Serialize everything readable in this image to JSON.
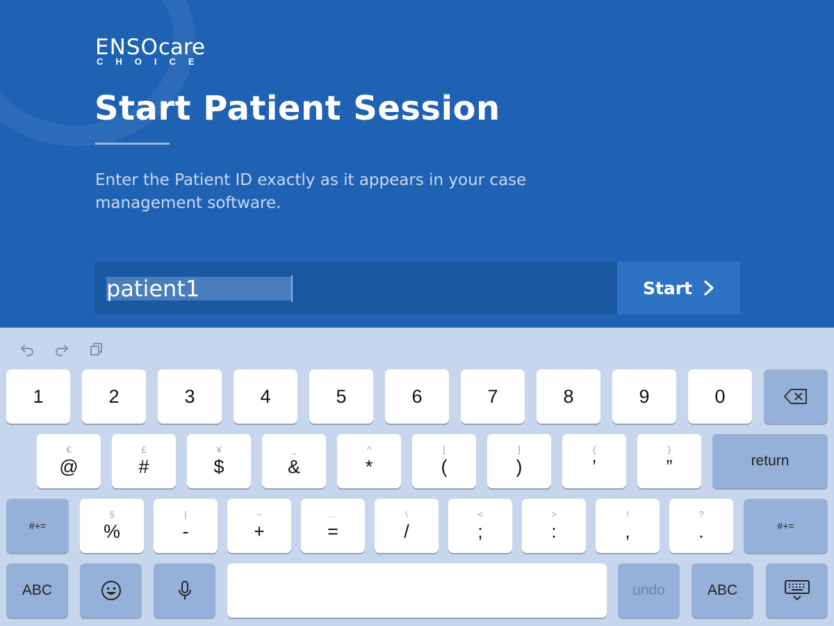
{
  "app": {
    "logo_brand_part1": "ENSO",
    "logo_brand_part2": "care",
    "logo_sub": "CHOICE",
    "title": "Start Patient Session",
    "instructions": "Enter the Patient ID exactly as it appears in your case management software.",
    "patient_id_value": "patient1",
    "start_label": "Start"
  },
  "colors": {
    "background": "#1f62b3",
    "input_bg": "#1a58a1",
    "start_bg": "#2e73c3",
    "keyboard_bg": "#c7d6ec",
    "key_dark": "#95b1d9"
  },
  "keyboard": {
    "toolbar": [
      "undo-icon",
      "redo-icon",
      "paste-icon"
    ],
    "row1": [
      "1",
      "2",
      "3",
      "4",
      "5",
      "6",
      "7",
      "8",
      "9",
      "0"
    ],
    "row1_delete": "delete-icon",
    "row2": [
      {
        "sub": "€",
        "main": "@"
      },
      {
        "sub": "£",
        "main": "#"
      },
      {
        "sub": "¥",
        "main": "$"
      },
      {
        "sub": "_",
        "main": "&"
      },
      {
        "sub": "^",
        "main": "*"
      },
      {
        "sub": "[",
        "main": "("
      },
      {
        "sub": "]",
        "main": ")"
      },
      {
        "sub": "{",
        "main": "’"
      },
      {
        "sub": "}",
        "main": "”"
      }
    ],
    "return_label": "return",
    "shift_label": "#+=",
    "row3": [
      {
        "sub": "§",
        "main": "%"
      },
      {
        "sub": "|",
        "main": "-"
      },
      {
        "sub": "~",
        "main": "+"
      },
      {
        "sub": "…",
        "main": "="
      },
      {
        "sub": "\\",
        "main": "/"
      },
      {
        "sub": "<",
        "main": ";"
      },
      {
        "sub": ">",
        "main": ":"
      },
      {
        "sub": "!",
        "main": ","
      },
      {
        "sub": "?",
        "main": "."
      }
    ],
    "abc_label": "ABC",
    "undo_label": "undo",
    "emoji_icon": "emoji-icon",
    "mic_icon": "microphone-icon",
    "hide_icon": "keyboard-hide-icon"
  }
}
